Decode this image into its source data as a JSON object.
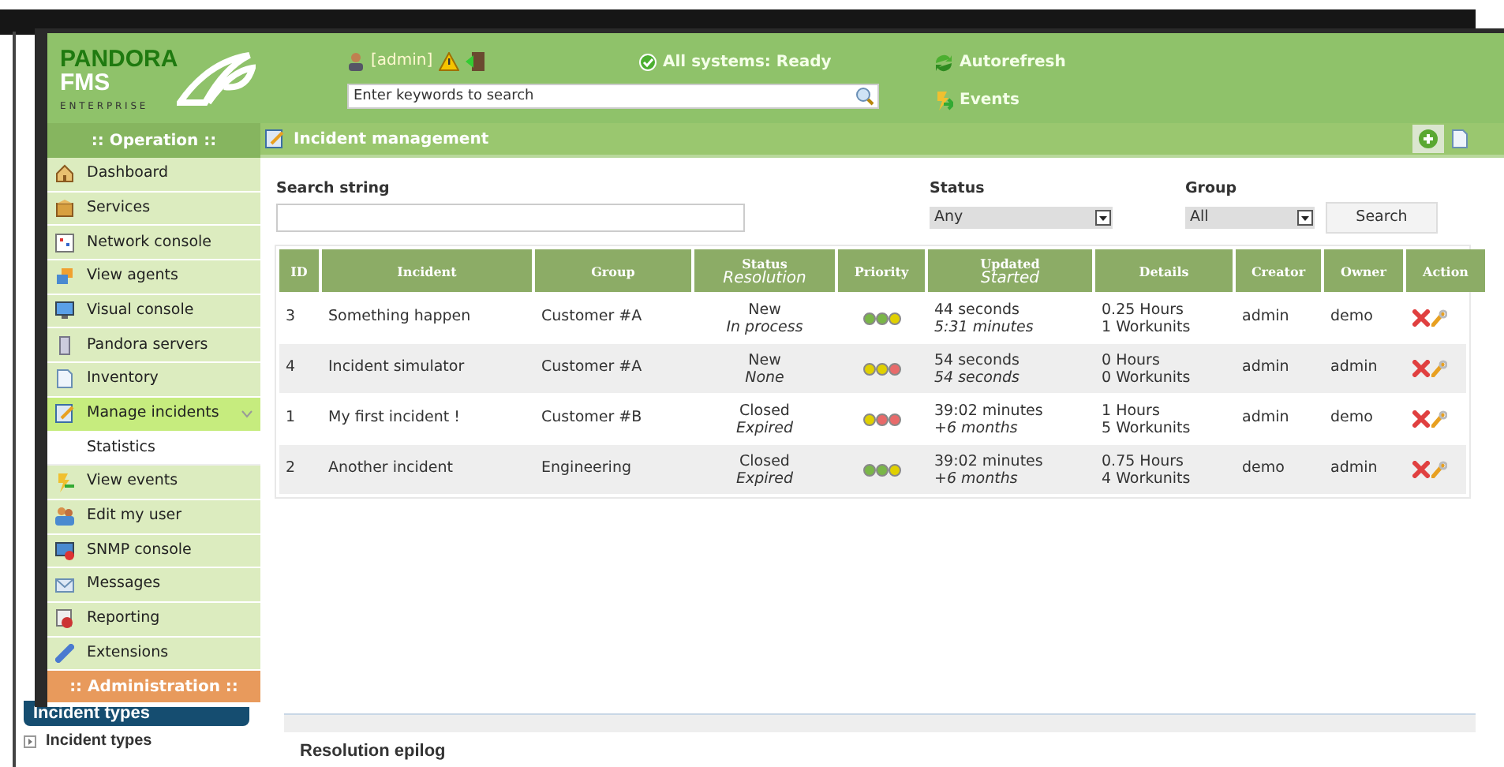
{
  "header": {
    "logo": {
      "brand": "PANDORA",
      "product": "FMS",
      "edition": "E N T E R P R I S E"
    },
    "user": "[admin]",
    "system_status": "All systems: Ready",
    "search": {
      "placeholder": "Enter keywords to search"
    },
    "links": [
      "Autorefresh",
      "Events"
    ]
  },
  "sidebar": {
    "section": ":: Operation ::",
    "items": [
      {
        "label": "Dashboard",
        "selected": false
      },
      {
        "label": "Services",
        "selected": false
      },
      {
        "label": "Network console",
        "selected": false
      },
      {
        "label": "View agents",
        "selected": false
      },
      {
        "label": "Visual console",
        "selected": false
      },
      {
        "label": "Pandora servers",
        "selected": false
      },
      {
        "label": "Inventory",
        "selected": false
      },
      {
        "label": "Manage incidents",
        "selected": true,
        "expanded": true,
        "children": [
          {
            "label": "Statistics"
          }
        ]
      },
      {
        "label": "View events",
        "selected": false
      },
      {
        "label": "Edit my user",
        "selected": false
      },
      {
        "label": "SNMP console",
        "selected": false
      },
      {
        "label": "Messages",
        "selected": false
      },
      {
        "label": "Reporting",
        "selected": false
      },
      {
        "label": "Extensions",
        "selected": false
      }
    ],
    "admin_section": ":: Administration ::"
  },
  "page_title": "Incident management",
  "filters": {
    "search_label": "Search string",
    "status_label": "Status",
    "status_value": "Any",
    "group_label": "Group",
    "group_value": "All",
    "search_button": "Search"
  },
  "table": {
    "columns": [
      {
        "title": "ID"
      },
      {
        "title": "Incident"
      },
      {
        "title": "Group"
      },
      {
        "title": "Status",
        "subtitle": "Resolution"
      },
      {
        "title": "Priority"
      },
      {
        "title": "Updated",
        "subtitle": "Started"
      },
      {
        "title": "Details"
      },
      {
        "title": "Creator"
      },
      {
        "title": "Owner"
      },
      {
        "title": "Action"
      }
    ],
    "rows": [
      {
        "id": "3",
        "incident": "Something happen",
        "group": "Customer #A",
        "status": "New",
        "resolution": "In process",
        "priority": [
          {
            "color": "#7ab648"
          },
          {
            "color": "#7ab648"
          },
          {
            "color": "#e0d000"
          }
        ],
        "updated": "44 seconds",
        "started": "5:31 minutes",
        "hours": "0.25 Hours",
        "workunits": "1 Workunits",
        "creator": "admin",
        "owner": "demo"
      },
      {
        "id": "4",
        "incident": "Incident simulator",
        "group": "Customer #A",
        "status": "New",
        "resolution": "None",
        "priority": [
          {
            "color": "#e0d000"
          },
          {
            "color": "#e0d000"
          },
          {
            "color": "#e86a6a"
          }
        ],
        "updated": "54 seconds",
        "started": "54 seconds",
        "hours": "0 Hours",
        "workunits": "0 Workunits",
        "creator": "admin",
        "owner": "admin"
      },
      {
        "id": "1",
        "incident": "My first incident !",
        "group": "Customer #B",
        "status": "Closed",
        "resolution": "Expired",
        "priority": [
          {
            "color": "#e0d000"
          },
          {
            "color": "#e86a6a"
          },
          {
            "color": "#e86a6a"
          }
        ],
        "updated": "39:02 minutes",
        "started": "+6 months",
        "hours": "1 Hours",
        "workunits": "5 Workunits",
        "creator": "admin",
        "owner": "demo"
      },
      {
        "id": "2",
        "incident": "Another incident",
        "group": "Engineering",
        "status": "Closed",
        "resolution": "Expired",
        "priority": [
          {
            "color": "#7ab648"
          },
          {
            "color": "#7ab648"
          },
          {
            "color": "#e0d000"
          }
        ],
        "updated": "39:02 minutes",
        "started": "+6 months",
        "hours": "0.75 Hours",
        "workunits": "4 Workunits",
        "creator": "demo",
        "owner": "admin"
      }
    ]
  },
  "background_window": {
    "section_header": "Incident types",
    "tree_item": "Incident types",
    "field_label": "Resolution epilog"
  }
}
